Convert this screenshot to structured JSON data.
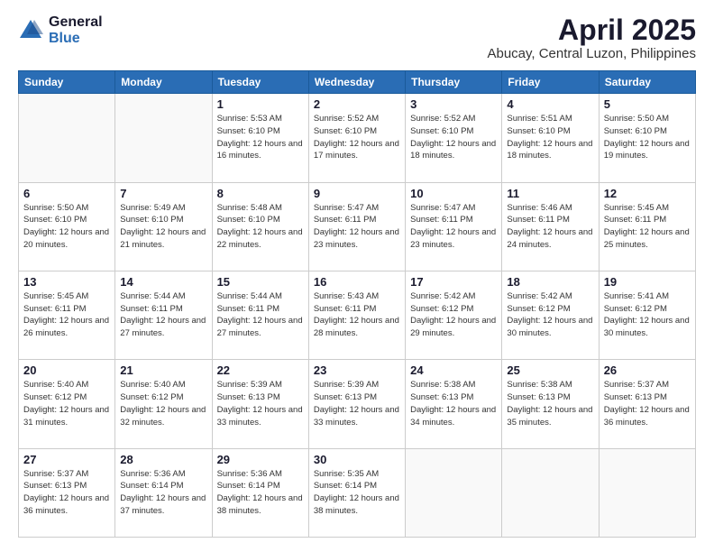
{
  "header": {
    "logo_general": "General",
    "logo_blue": "Blue",
    "title": "April 2025",
    "subtitle": "Abucay, Central Luzon, Philippines"
  },
  "weekdays": [
    "Sunday",
    "Monday",
    "Tuesday",
    "Wednesday",
    "Thursday",
    "Friday",
    "Saturday"
  ],
  "weeks": [
    [
      {
        "num": "",
        "sunrise": "",
        "sunset": "",
        "daylight": ""
      },
      {
        "num": "",
        "sunrise": "",
        "sunset": "",
        "daylight": ""
      },
      {
        "num": "1",
        "sunrise": "Sunrise: 5:53 AM",
        "sunset": "Sunset: 6:10 PM",
        "daylight": "Daylight: 12 hours and 16 minutes."
      },
      {
        "num": "2",
        "sunrise": "Sunrise: 5:52 AM",
        "sunset": "Sunset: 6:10 PM",
        "daylight": "Daylight: 12 hours and 17 minutes."
      },
      {
        "num": "3",
        "sunrise": "Sunrise: 5:52 AM",
        "sunset": "Sunset: 6:10 PM",
        "daylight": "Daylight: 12 hours and 18 minutes."
      },
      {
        "num": "4",
        "sunrise": "Sunrise: 5:51 AM",
        "sunset": "Sunset: 6:10 PM",
        "daylight": "Daylight: 12 hours and 18 minutes."
      },
      {
        "num": "5",
        "sunrise": "Sunrise: 5:50 AM",
        "sunset": "Sunset: 6:10 PM",
        "daylight": "Daylight: 12 hours and 19 minutes."
      }
    ],
    [
      {
        "num": "6",
        "sunrise": "Sunrise: 5:50 AM",
        "sunset": "Sunset: 6:10 PM",
        "daylight": "Daylight: 12 hours and 20 minutes."
      },
      {
        "num": "7",
        "sunrise": "Sunrise: 5:49 AM",
        "sunset": "Sunset: 6:10 PM",
        "daylight": "Daylight: 12 hours and 21 minutes."
      },
      {
        "num": "8",
        "sunrise": "Sunrise: 5:48 AM",
        "sunset": "Sunset: 6:10 PM",
        "daylight": "Daylight: 12 hours and 22 minutes."
      },
      {
        "num": "9",
        "sunrise": "Sunrise: 5:47 AM",
        "sunset": "Sunset: 6:11 PM",
        "daylight": "Daylight: 12 hours and 23 minutes."
      },
      {
        "num": "10",
        "sunrise": "Sunrise: 5:47 AM",
        "sunset": "Sunset: 6:11 PM",
        "daylight": "Daylight: 12 hours and 23 minutes."
      },
      {
        "num": "11",
        "sunrise": "Sunrise: 5:46 AM",
        "sunset": "Sunset: 6:11 PM",
        "daylight": "Daylight: 12 hours and 24 minutes."
      },
      {
        "num": "12",
        "sunrise": "Sunrise: 5:45 AM",
        "sunset": "Sunset: 6:11 PM",
        "daylight": "Daylight: 12 hours and 25 minutes."
      }
    ],
    [
      {
        "num": "13",
        "sunrise": "Sunrise: 5:45 AM",
        "sunset": "Sunset: 6:11 PM",
        "daylight": "Daylight: 12 hours and 26 minutes."
      },
      {
        "num": "14",
        "sunrise": "Sunrise: 5:44 AM",
        "sunset": "Sunset: 6:11 PM",
        "daylight": "Daylight: 12 hours and 27 minutes."
      },
      {
        "num": "15",
        "sunrise": "Sunrise: 5:44 AM",
        "sunset": "Sunset: 6:11 PM",
        "daylight": "Daylight: 12 hours and 27 minutes."
      },
      {
        "num": "16",
        "sunrise": "Sunrise: 5:43 AM",
        "sunset": "Sunset: 6:11 PM",
        "daylight": "Daylight: 12 hours and 28 minutes."
      },
      {
        "num": "17",
        "sunrise": "Sunrise: 5:42 AM",
        "sunset": "Sunset: 6:12 PM",
        "daylight": "Daylight: 12 hours and 29 minutes."
      },
      {
        "num": "18",
        "sunrise": "Sunrise: 5:42 AM",
        "sunset": "Sunset: 6:12 PM",
        "daylight": "Daylight: 12 hours and 30 minutes."
      },
      {
        "num": "19",
        "sunrise": "Sunrise: 5:41 AM",
        "sunset": "Sunset: 6:12 PM",
        "daylight": "Daylight: 12 hours and 30 minutes."
      }
    ],
    [
      {
        "num": "20",
        "sunrise": "Sunrise: 5:40 AM",
        "sunset": "Sunset: 6:12 PM",
        "daylight": "Daylight: 12 hours and 31 minutes."
      },
      {
        "num": "21",
        "sunrise": "Sunrise: 5:40 AM",
        "sunset": "Sunset: 6:12 PM",
        "daylight": "Daylight: 12 hours and 32 minutes."
      },
      {
        "num": "22",
        "sunrise": "Sunrise: 5:39 AM",
        "sunset": "Sunset: 6:13 PM",
        "daylight": "Daylight: 12 hours and 33 minutes."
      },
      {
        "num": "23",
        "sunrise": "Sunrise: 5:39 AM",
        "sunset": "Sunset: 6:13 PM",
        "daylight": "Daylight: 12 hours and 33 minutes."
      },
      {
        "num": "24",
        "sunrise": "Sunrise: 5:38 AM",
        "sunset": "Sunset: 6:13 PM",
        "daylight": "Daylight: 12 hours and 34 minutes."
      },
      {
        "num": "25",
        "sunrise": "Sunrise: 5:38 AM",
        "sunset": "Sunset: 6:13 PM",
        "daylight": "Daylight: 12 hours and 35 minutes."
      },
      {
        "num": "26",
        "sunrise": "Sunrise: 5:37 AM",
        "sunset": "Sunset: 6:13 PM",
        "daylight": "Daylight: 12 hours and 36 minutes."
      }
    ],
    [
      {
        "num": "27",
        "sunrise": "Sunrise: 5:37 AM",
        "sunset": "Sunset: 6:13 PM",
        "daylight": "Daylight: 12 hours and 36 minutes."
      },
      {
        "num": "28",
        "sunrise": "Sunrise: 5:36 AM",
        "sunset": "Sunset: 6:14 PM",
        "daylight": "Daylight: 12 hours and 37 minutes."
      },
      {
        "num": "29",
        "sunrise": "Sunrise: 5:36 AM",
        "sunset": "Sunset: 6:14 PM",
        "daylight": "Daylight: 12 hours and 38 minutes."
      },
      {
        "num": "30",
        "sunrise": "Sunrise: 5:35 AM",
        "sunset": "Sunset: 6:14 PM",
        "daylight": "Daylight: 12 hours and 38 minutes."
      },
      {
        "num": "",
        "sunrise": "",
        "sunset": "",
        "daylight": ""
      },
      {
        "num": "",
        "sunrise": "",
        "sunset": "",
        "daylight": ""
      },
      {
        "num": "",
        "sunrise": "",
        "sunset": "",
        "daylight": ""
      }
    ]
  ]
}
